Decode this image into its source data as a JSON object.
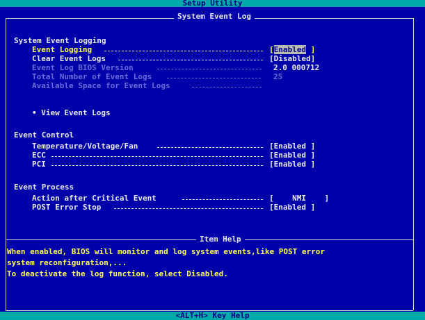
{
  "window_title": "Setup Utility",
  "panel_title": "System Event Log",
  "logging": {
    "heading": "System Event Logging",
    "event_logging": {
      "label": "Event Logging",
      "value": "Enabled",
      "close": "]"
    },
    "clear_event_logs": {
      "label": "Clear Event Logs",
      "value": "[Disabled]"
    },
    "bios_version": {
      "label": "Event Log BIOS Version",
      "value": "2.0 000712"
    },
    "total_events": {
      "label": "Total Number of Event Logs",
      "value": "25"
    },
    "available_space": {
      "label": "Available Space for Event Logs"
    },
    "view_event_logs": "• View Event Logs"
  },
  "control": {
    "heading": "Event Control",
    "temperature": {
      "label": "Temperature/Voltage/Fan",
      "value": "[Enabled ]"
    },
    "ecc": {
      "label": "ECC",
      "value": "[Enabled ]"
    },
    "pci": {
      "label": "PCI",
      "value": "[Enabled ]"
    }
  },
  "process": {
    "heading": "Event Process",
    "critical": {
      "label": "Action after Critical Event",
      "value": "[    NMI    ]"
    },
    "post_error_stop": {
      "label": "POST Error Stop",
      "value": "[Enabled ]"
    }
  },
  "help": {
    "title": "Item Help",
    "line1": "When enabled, BIOS will monitor and log system events,like POST error",
    "line2": "system reconfiguration,...",
    "line3": "To deactivate the log function, select Disabled."
  },
  "footer": "<ALT+H>  Key Help",
  "colors": {
    "background": "#0000aa",
    "highlight": "#ffff55",
    "bars": "#00aaaa"
  }
}
